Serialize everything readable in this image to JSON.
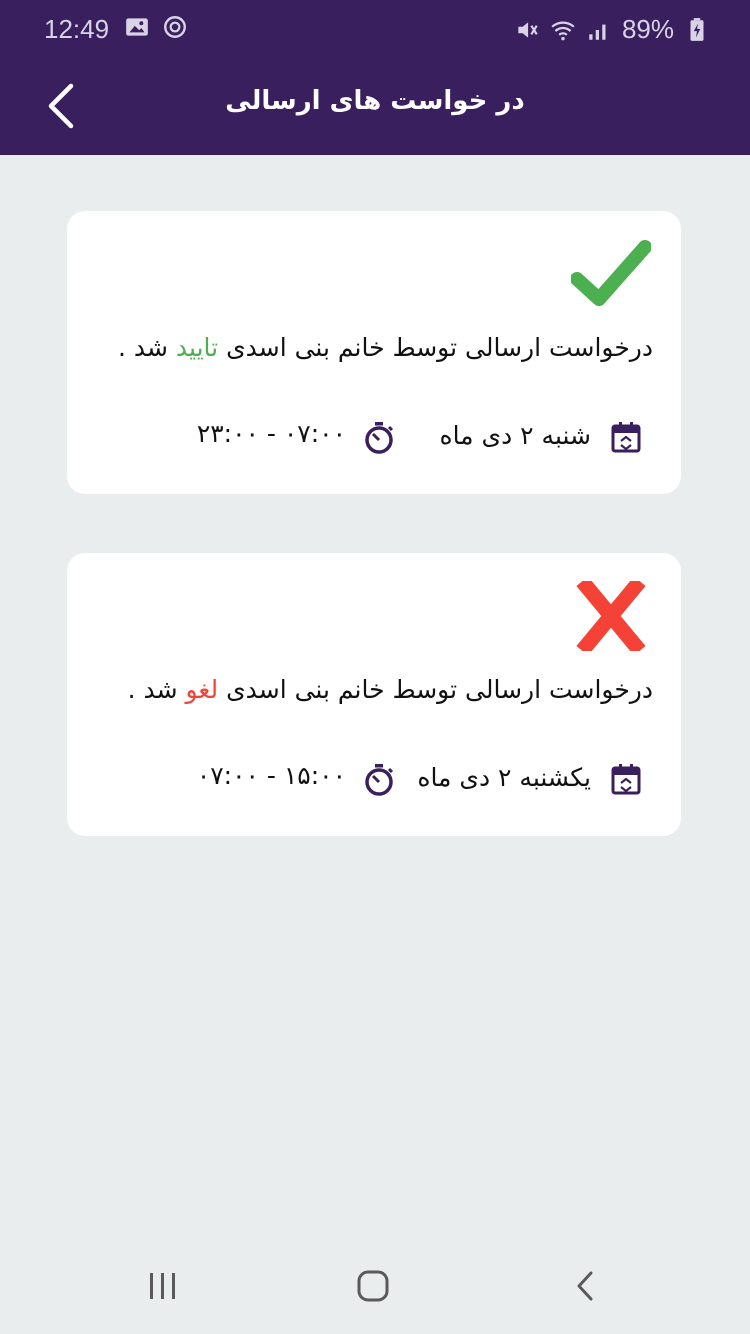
{
  "status_bar": {
    "time": "12:49",
    "battery": "89%",
    "icons_left": [
      "image-icon",
      "sync-icon"
    ],
    "icons_right": [
      "mute-icon",
      "wifi-icon",
      "signal-icon",
      "battery-icon"
    ]
  },
  "header": {
    "title": "در خواست های ارسالی",
    "back_icon": "chevron-left-icon"
  },
  "requests": [
    {
      "status": "approved",
      "status_icon": "check-icon",
      "message_prefix": "درخواست ارسالی توسط خانم بنی اسدی",
      "status_word": "تایید",
      "message_suffix": "شد .",
      "date": "شنبه ۲ دی ماه",
      "time_range": "۲۳:۰۰ - ۰۷:۰۰"
    },
    {
      "status": "cancelled",
      "status_icon": "close-icon",
      "message_prefix": "درخواست ارسالی توسط خانم بنی اسدی",
      "status_word": "لغو",
      "message_suffix": "شد .",
      "date": "یکشنبه ۲ دی ماه",
      "time_range": "۰۷:۰۰ - ۱۵:۰۰"
    }
  ],
  "colors": {
    "primary": "#3a1f5e",
    "approved": "#4caf50",
    "cancelled": "#f44336",
    "background": "#e9edee"
  },
  "nav": {
    "recents_icon": "recents-icon",
    "home_icon": "home-icon",
    "back_icon": "back-icon"
  }
}
